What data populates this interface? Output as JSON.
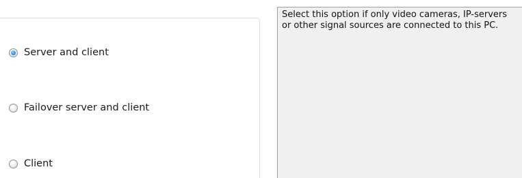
{
  "options": [
    {
      "label": "Server and client",
      "selected": true
    },
    {
      "label": "Failover server and client",
      "selected": false
    },
    {
      "label": "Client",
      "selected": false
    }
  ],
  "description": "Select this option if only video cameras, IP-servers or other signal sources are connected to this PC.",
  "colors": {
    "panel_background": "#f0f0f0",
    "radio_selected": "#3c8fd8"
  }
}
